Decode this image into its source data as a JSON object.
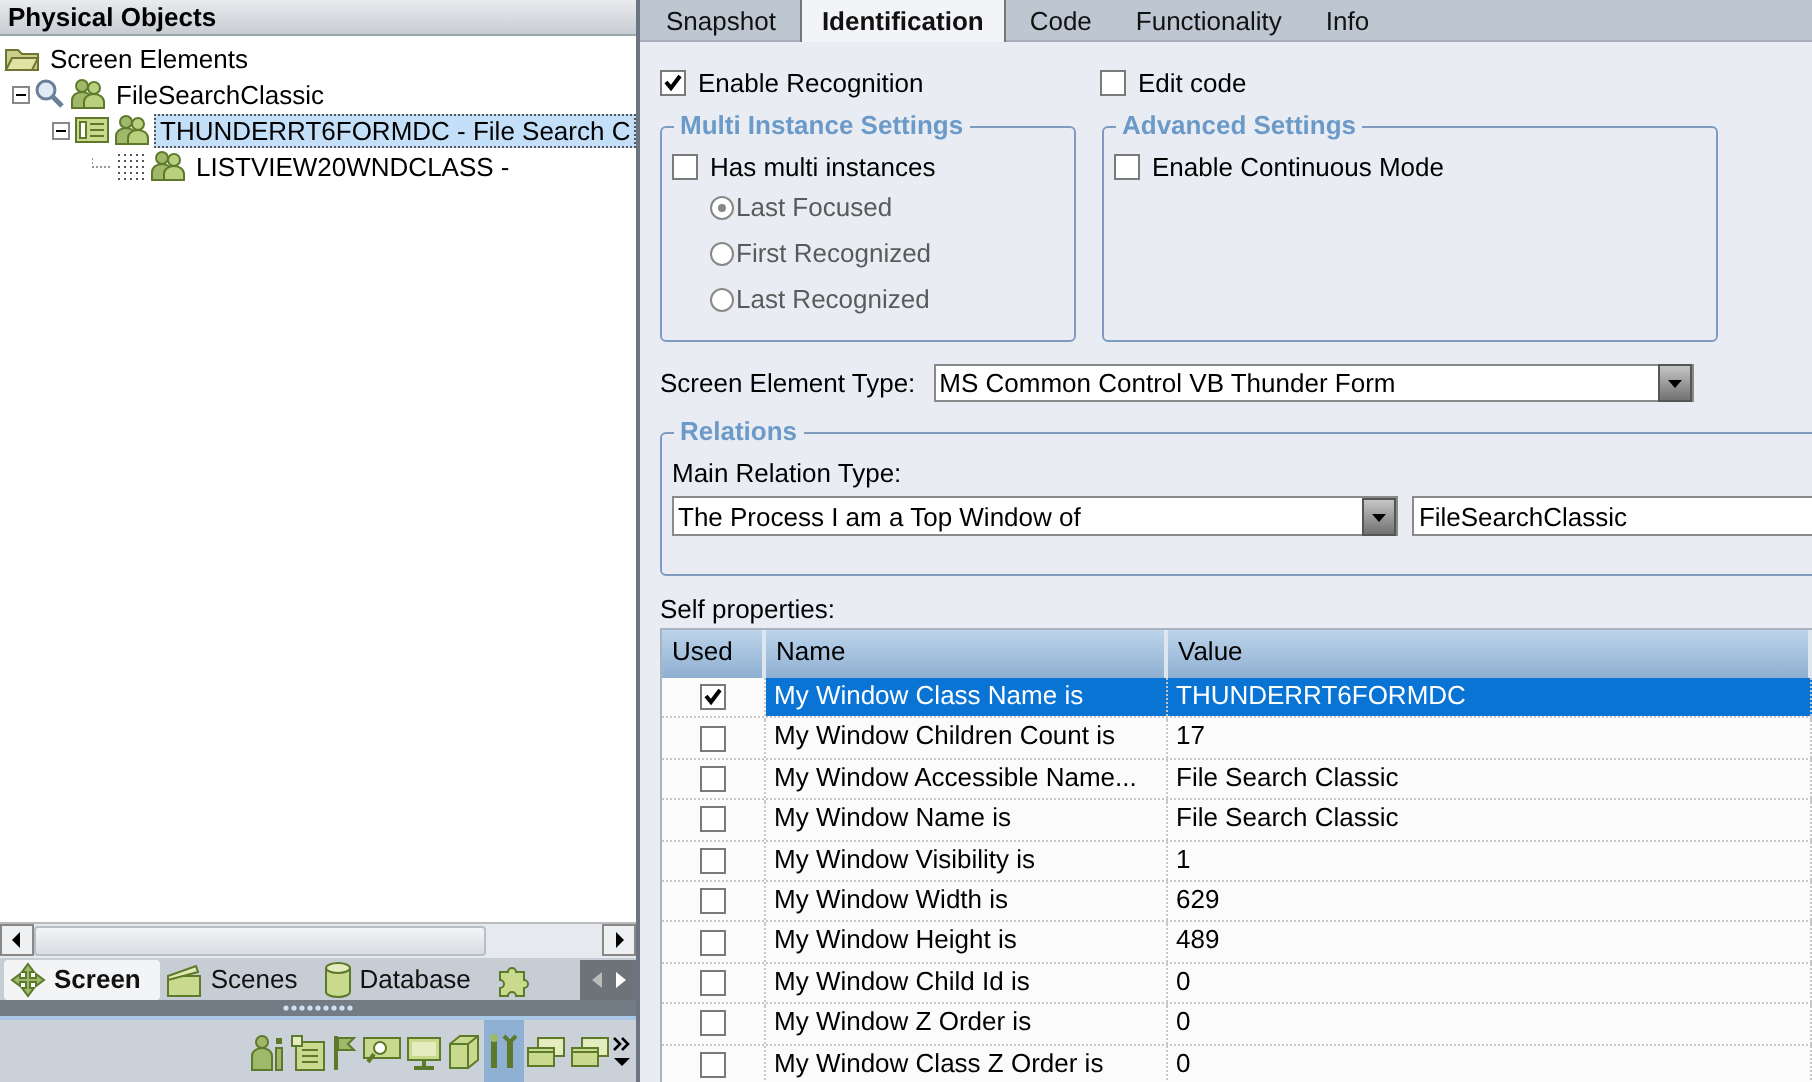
{
  "left_panel": {
    "title": "Physical Objects",
    "tree": [
      {
        "label": "Screen Elements",
        "kind": "folder",
        "selected": false,
        "children": [
          {
            "label": "FileSearchClassic",
            "kind": "process",
            "expanded": true,
            "selected": false,
            "children": [
              {
                "label": "THUNDERRT6FORMDC - File Search C",
                "kind": "window",
                "expanded": true,
                "selected": true,
                "children": [
                  {
                    "label": "LISTVIEW20WNDCLASS -",
                    "kind": "control",
                    "selected": false
                  }
                ]
              }
            ]
          }
        ]
      }
    ],
    "tabs": [
      {
        "label": "Screen",
        "kind": "cross",
        "selected": true
      },
      {
        "label": "Scenes",
        "kind": "clapper",
        "selected": false
      },
      {
        "label": "Database",
        "kind": "cylinder",
        "selected": false
      },
      {
        "kind": "puzzle",
        "selected": false
      }
    ],
    "toolbar": [
      {
        "kind": "people-info",
        "selected": false
      },
      {
        "kind": "window-list",
        "selected": false
      },
      {
        "kind": "flag",
        "selected": false
      },
      {
        "kind": "monitor-search",
        "selected": false
      },
      {
        "kind": "monitor",
        "selected": false
      },
      {
        "kind": "cube",
        "selected": false
      },
      {
        "kind": "tools",
        "selected": true
      },
      {
        "kind": "windows",
        "selected": false
      },
      {
        "kind": "windows",
        "selected": false
      }
    ]
  },
  "right_panel": {
    "tabs": [
      {
        "label": "Snapshot",
        "selected": false
      },
      {
        "label": "Identification",
        "selected": true
      },
      {
        "label": "Code",
        "selected": false
      },
      {
        "label": "Functionality",
        "selected": false
      },
      {
        "label": "Info",
        "selected": false
      }
    ],
    "enable_recognition": {
      "label": "Enable Recognition",
      "checked": true
    },
    "edit_code": {
      "label": "Edit code",
      "checked": false
    },
    "multi_instance": {
      "title": "Multi Instance Settings",
      "has_multi": {
        "label": "Has multi instances",
        "checked": false
      },
      "options": [
        {
          "label": "Last Focused",
          "selected": true,
          "disabled": true
        },
        {
          "label": "First Recognized",
          "selected": false,
          "disabled": true
        },
        {
          "label": "Last Recognized",
          "selected": false,
          "disabled": true
        }
      ]
    },
    "advanced": {
      "title": "Advanced Settings",
      "continuous": {
        "label": "Enable Continuous Mode",
        "checked": false
      }
    },
    "screen_element_type": {
      "label": "Screen Element Type:",
      "value": "MS Common Control VB Thunder Form"
    },
    "relations": {
      "title": "Relations",
      "main_relation_label": "Main Relation Type:",
      "relation_value": "The Process I am a Top Window of",
      "target_value": "FileSearchClassic"
    },
    "self_properties": {
      "label": "Self properties:",
      "columns": [
        "Used",
        "Name",
        "Value"
      ],
      "rows": [
        {
          "used": true,
          "selected": true,
          "name": "My Window Class Name is",
          "value": "THUNDERRT6FORMDC"
        },
        {
          "used": false,
          "selected": false,
          "name": "My Window Children Count is",
          "value": "17"
        },
        {
          "used": false,
          "selected": false,
          "name": "My Window Accessible Name...",
          "value": "File Search Classic"
        },
        {
          "used": false,
          "selected": false,
          "name": "My Window Name is",
          "value": "File Search Classic"
        },
        {
          "used": false,
          "selected": false,
          "name": "My Window Visibility is",
          "value": "1"
        },
        {
          "used": false,
          "selected": false,
          "name": "My Window Width is",
          "value": "629"
        },
        {
          "used": false,
          "selected": false,
          "name": "My Window Height is",
          "value": "489"
        },
        {
          "used": false,
          "selected": false,
          "name": "My Window Child Id is",
          "value": "0"
        },
        {
          "used": false,
          "selected": false,
          "name": "My Window Z Order is",
          "value": "0"
        },
        {
          "used": false,
          "selected": false,
          "name": "My Window Class Z Order is",
          "value": "0"
        }
      ]
    }
  }
}
